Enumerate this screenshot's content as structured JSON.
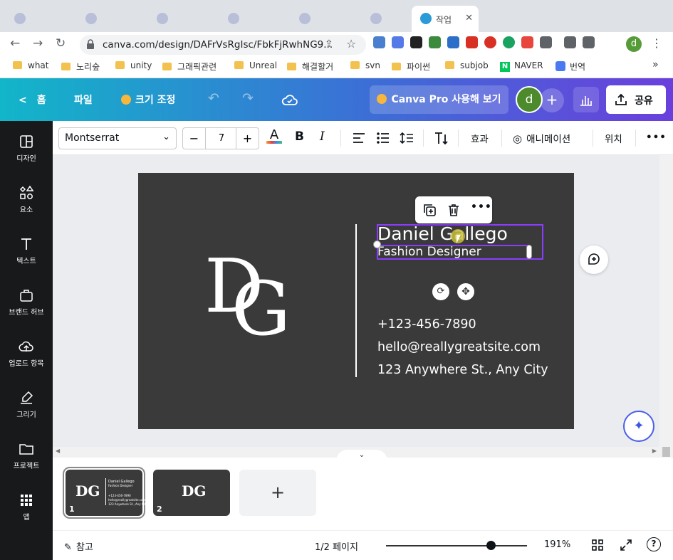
{
  "browser": {
    "active_tab_title": "작업",
    "url": "canva.com/design/DAFrVsRgIsc/FbkFjRwhNG9...",
    "profile_initial": "d",
    "bookmarks": [
      "what",
      "노리숲",
      "unity",
      "그래픽관련",
      "Unreal",
      "해결할거",
      "svn",
      "파이썬",
      "subjob",
      "NAVER",
      "번역"
    ],
    "bookmarks_more": "»"
  },
  "editor_top": {
    "home": "홈",
    "file": "파일",
    "resize": "크기 조정",
    "pro_button": "Canva Pro 사용해 보기",
    "avatar_initial": "d",
    "share": "공유"
  },
  "sidebar": {
    "items": [
      "디자인",
      "요소",
      "텍스트",
      "브랜드 허브",
      "업로드 항목",
      "그리기",
      "프로젝트",
      "앱"
    ]
  },
  "toolbar": {
    "font": "Montserrat",
    "size_minus": "−",
    "font_size": "7",
    "size_plus": "+",
    "bold": "B",
    "italic": "I",
    "effects": "효과",
    "animate": "애니메이션",
    "position": "위치",
    "more": "•••"
  },
  "card": {
    "monogram_d": "D",
    "monogram_g": "G",
    "name": "Daniel Gallego",
    "title": "Fashion Designer",
    "phone": "+123-456-7890",
    "email": "hello@reallygreatsite.com",
    "address": "123 Anywhere St., Any City"
  },
  "pages": {
    "thumbs": [
      {
        "num": "1",
        "name": "Daniel Gallego",
        "title": "Fashion Designer",
        "phone": "+123-456-7890",
        "email": "hello@reallygreatsite.com",
        "address": "123 Anywhere St., Any City"
      },
      {
        "num": "2"
      }
    ],
    "add": "+"
  },
  "footer": {
    "notes": "참고",
    "page_indicator": "1/2 페이지",
    "zoom": "191%",
    "zoom_fraction": 0.74,
    "help": "?"
  },
  "colors": {
    "accent": "#8b3dff",
    "card_bg": "#3a3a3a",
    "sidebar_bg": "#18191b"
  }
}
